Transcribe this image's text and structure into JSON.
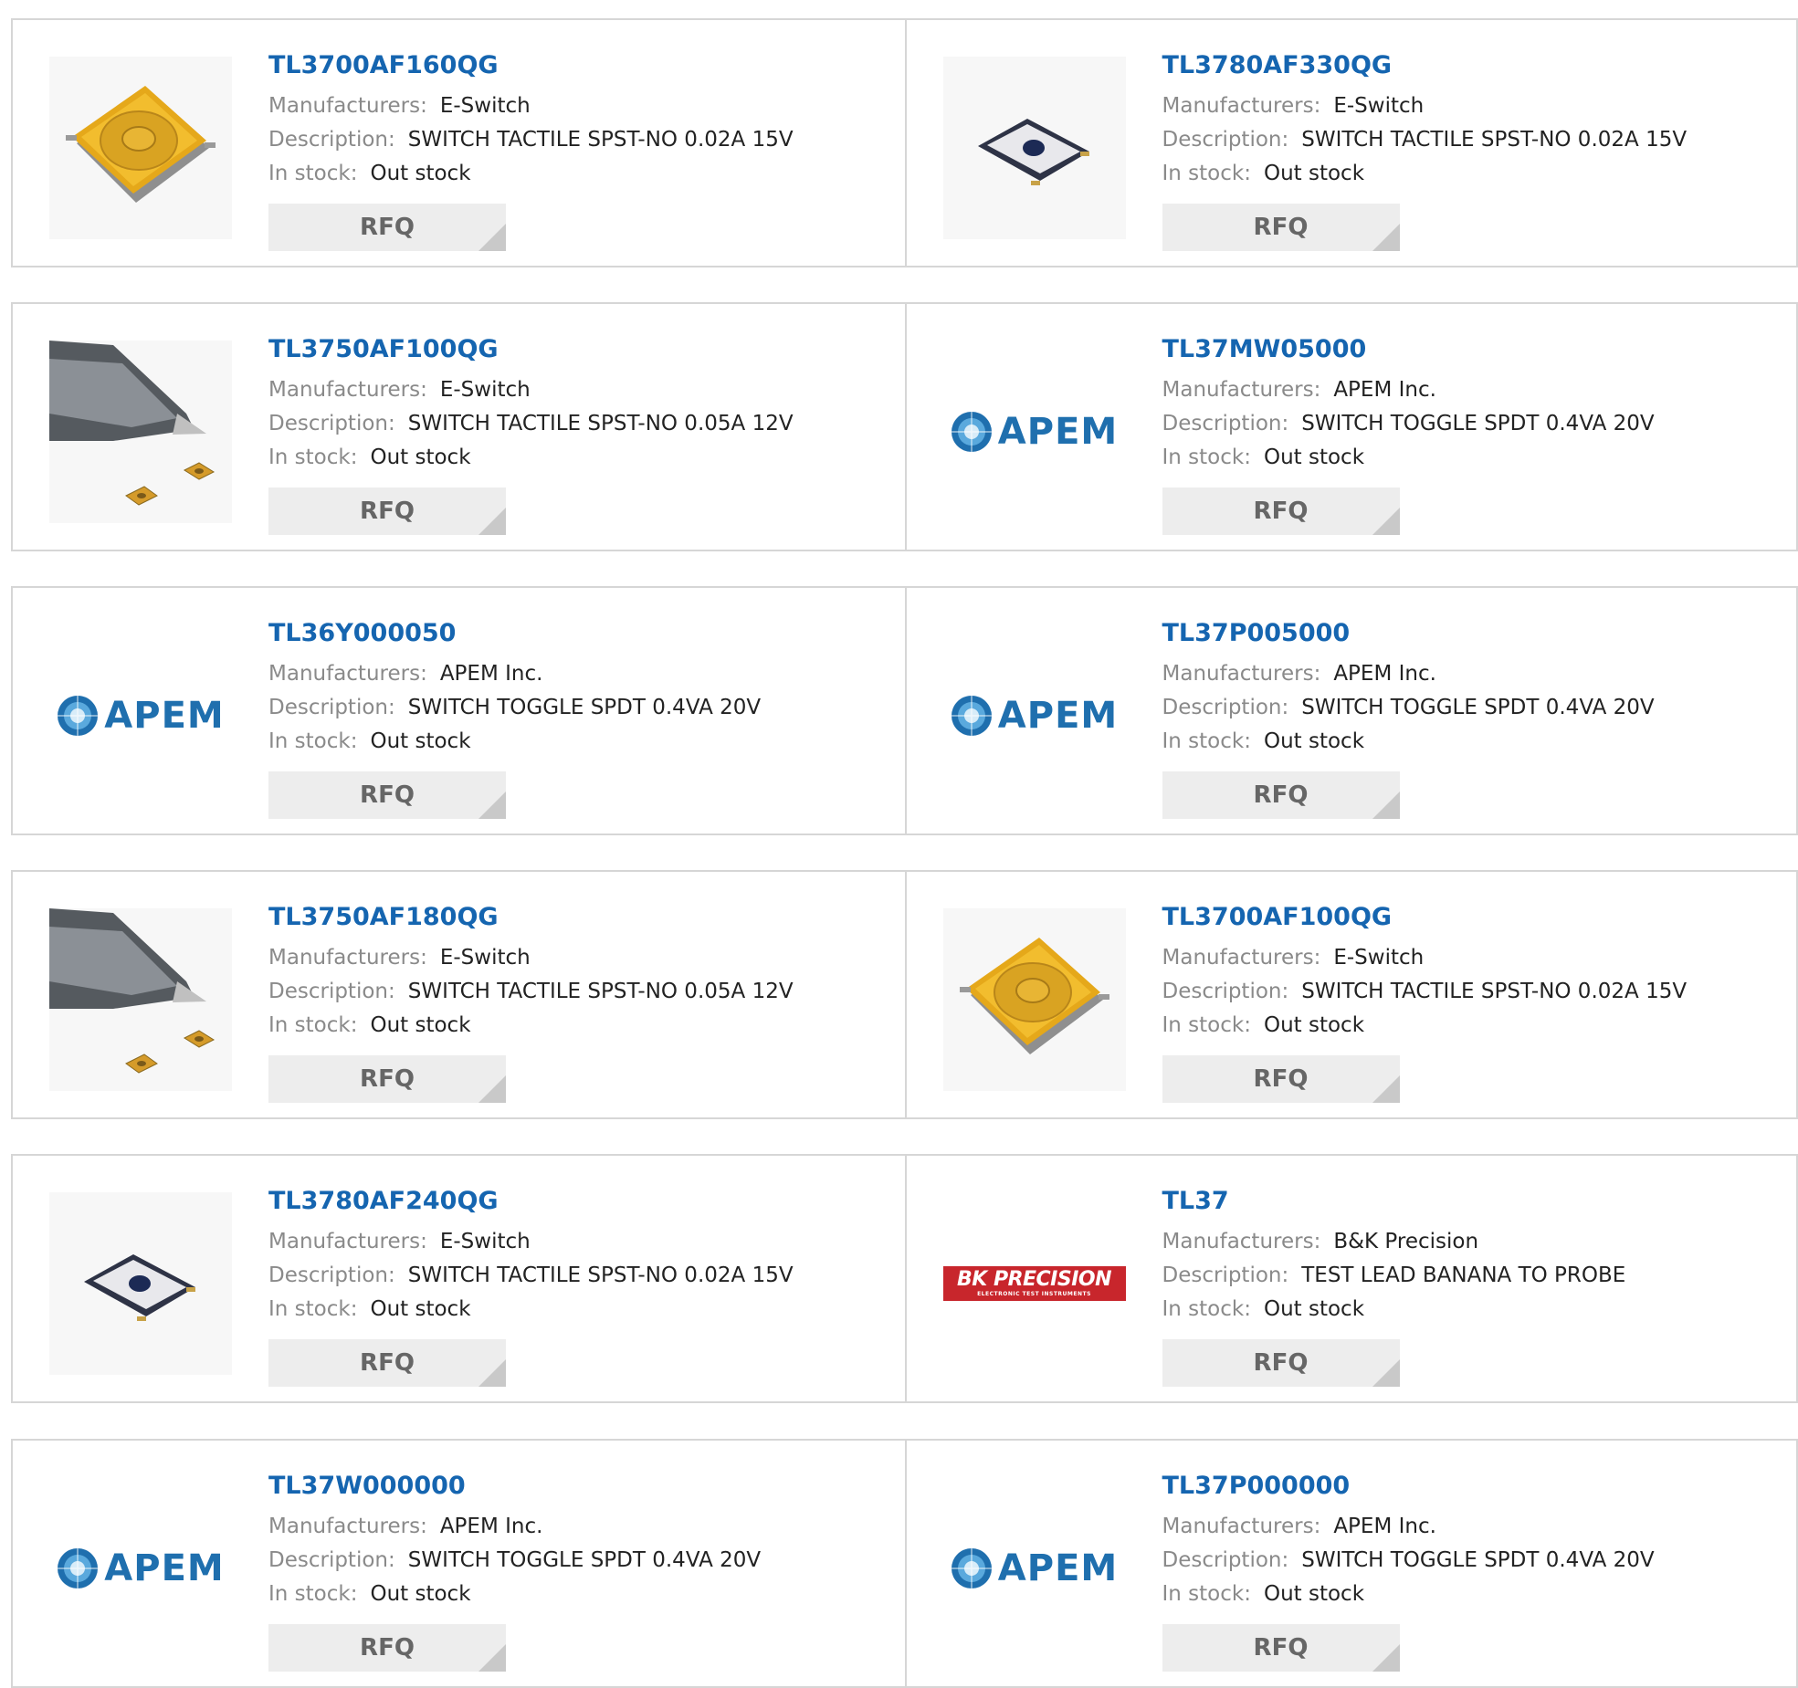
{
  "labels": {
    "manufacturers": "Manufacturers:",
    "description": "Description:",
    "in_stock": "In stock:",
    "rfq": "RFQ"
  },
  "colors": {
    "part_link": "#1565b0",
    "label_gray": "#8a8a8a",
    "border": "#d6d6d6",
    "button_bg": "#ededed",
    "apem_blue": "#1f6fae",
    "bk_red": "#c8262c"
  },
  "products": [
    {
      "part": "TL3700AF160QG",
      "manufacturer": "E-Switch",
      "description": "SWITCH TACTILE SPST-NO 0.02A 15V",
      "stock": "Out stock",
      "image": "tactile-switch-yellow"
    },
    {
      "part": "TL3780AF330QG",
      "manufacturer": "E-Switch",
      "description": "SWITCH TACTILE SPST-NO 0.02A 15V",
      "stock": "Out stock",
      "image": "tactile-switch-dark"
    },
    {
      "part": "TL3750AF100QG",
      "manufacturer": "E-Switch",
      "description": "SWITCH TACTILE SPST-NO 0.05A 12V",
      "stock": "Out stock",
      "image": "pen-tip-with-switches"
    },
    {
      "part": "TL37MW05000",
      "manufacturer": "APEM Inc.",
      "description": "SWITCH TOGGLE SPDT 0.4VA 20V",
      "stock": "Out stock",
      "image": "apem-logo"
    },
    {
      "part": "TL36Y000050",
      "manufacturer": "APEM Inc.",
      "description": "SWITCH TOGGLE SPDT 0.4VA 20V",
      "stock": "Out stock",
      "image": "apem-logo"
    },
    {
      "part": "TL37P005000",
      "manufacturer": "APEM Inc.",
      "description": "SWITCH TOGGLE SPDT 0.4VA 20V",
      "stock": "Out stock",
      "image": "apem-logo"
    },
    {
      "part": "TL3750AF180QG",
      "manufacturer": "E-Switch",
      "description": "SWITCH TACTILE SPST-NO 0.05A 12V",
      "stock": "Out stock",
      "image": "pen-tip-with-switches"
    },
    {
      "part": "TL3700AF100QG",
      "manufacturer": "E-Switch",
      "description": "SWITCH TACTILE SPST-NO 0.02A 15V",
      "stock": "Out stock",
      "image": "tactile-switch-yellow"
    },
    {
      "part": "TL3780AF240QG",
      "manufacturer": "E-Switch",
      "description": "SWITCH TACTILE SPST-NO 0.02A 15V",
      "stock": "Out stock",
      "image": "tactile-switch-dark"
    },
    {
      "part": "TL37",
      "manufacturer": "B&K Precision",
      "description": "TEST LEAD BANANA TO PROBE",
      "stock": "Out stock",
      "image": "bk-precision-logo"
    },
    {
      "part": "TL37W000000",
      "manufacturer": "APEM Inc.",
      "description": "SWITCH TOGGLE SPDT 0.4VA 20V",
      "stock": "Out stock",
      "image": "apem-logo"
    },
    {
      "part": "TL37P000000",
      "manufacturer": "APEM Inc.",
      "description": "SWITCH TOGGLE SPDT 0.4VA 20V",
      "stock": "Out stock",
      "image": "apem-logo"
    }
  ],
  "logos": {
    "apem": "APEM",
    "bk_main": "BK PRECISION",
    "bk_sub": "ELECTRONIC TEST INSTRUMENTS"
  }
}
